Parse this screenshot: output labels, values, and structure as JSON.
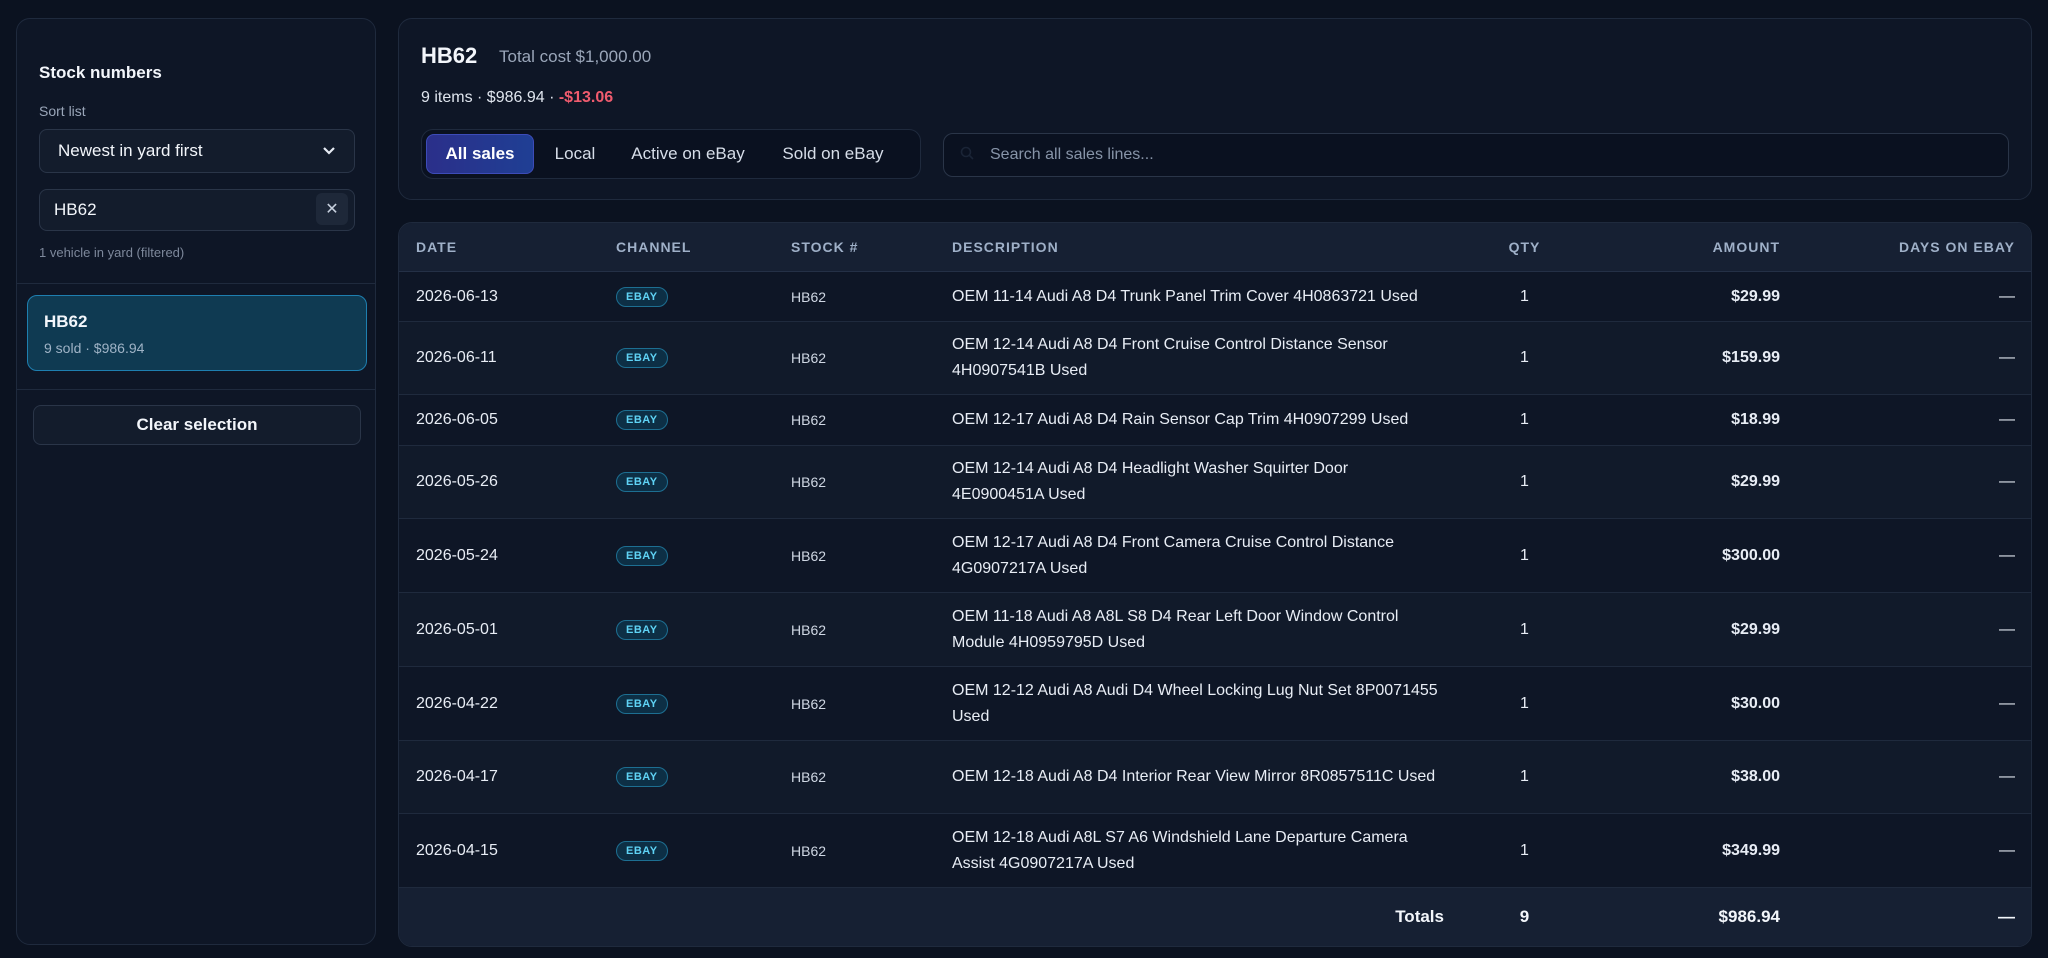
{
  "sidebar": {
    "title": "Stock numbers",
    "sort_label": "Sort list",
    "sort_value": "Newest in yard first",
    "search_value": "HB62",
    "clear_glyph": "✕",
    "count_text": "1 vehicle in yard (filtered)",
    "card": {
      "title": "HB62",
      "sub": "9 sold · $986.94"
    },
    "clear_selection": "Clear selection"
  },
  "header": {
    "title": "HB62",
    "total_cost": "Total cost $1,000.00",
    "summary": "9 items · $986.94 · ",
    "delta": "-$13.06",
    "tabs": [
      "All sales",
      "Local",
      "Active on eBay",
      "Sold on eBay"
    ],
    "active_tab": 0,
    "search_placeholder": "Search all sales lines..."
  },
  "table": {
    "columns": [
      "DATE",
      "CHANNEL",
      "STOCK #",
      "DESCRIPTION",
      "QTY",
      "AMOUNT",
      "DAYS ON EBAY"
    ],
    "rows": [
      {
        "date": "2026-06-13",
        "channel": "EBAY",
        "stock": "HB62",
        "desc": "OEM 11-14 Audi A8 D4 Trunk Panel Trim Cover 4H0863721 Used",
        "qty": "1",
        "amount": "$29.99",
        "days": "—"
      },
      {
        "date": "2026-06-11",
        "channel": "EBAY",
        "stock": "HB62",
        "desc": "OEM 12-14 Audi A8 D4 Front Cruise Control Distance Sensor 4H0907541B Used",
        "qty": "1",
        "amount": "$159.99",
        "days": "—"
      },
      {
        "date": "2026-06-05",
        "channel": "EBAY",
        "stock": "HB62",
        "desc": "OEM 12-17 Audi A8 D4 Rain Sensor Cap Trim 4H0907299 Used",
        "qty": "1",
        "amount": "$18.99",
        "days": "—"
      },
      {
        "date": "2026-05-26",
        "channel": "EBAY",
        "stock": "HB62",
        "desc": "OEM 12-14 Audi A8 D4 Headlight Washer Squirter Door 4E0900451A Used",
        "qty": "1",
        "amount": "$29.99",
        "days": "—"
      },
      {
        "date": "2026-05-24",
        "channel": "EBAY",
        "stock": "HB62",
        "desc": "OEM 12-17 Audi A8 D4 Front Camera Cruise Control Distance 4G0907217A Used",
        "qty": "1",
        "amount": "$300.00",
        "days": "—"
      },
      {
        "date": "2026-05-01",
        "channel": "EBAY",
        "stock": "HB62",
        "desc": "OEM 11-18 Audi A8 A8L S8 D4 Rear Left Door Window Control Module 4H0959795D Used",
        "qty": "1",
        "amount": "$29.99",
        "days": "—"
      },
      {
        "date": "2026-04-22",
        "channel": "EBAY",
        "stock": "HB62",
        "desc": "OEM 12-12 Audi A8 Audi D4 Wheel Locking Lug Nut Set 8P0071455 Used",
        "qty": "1",
        "amount": "$30.00",
        "days": "—"
      },
      {
        "date": "2026-04-17",
        "channel": "EBAY",
        "stock": "HB62",
        "desc": "OEM 12-18 Audi A8 D4 Interior Rear View Mirror 8R0857511C Used",
        "qty": "1",
        "amount": "$38.00",
        "days": "—"
      },
      {
        "date": "2026-04-15",
        "channel": "EBAY",
        "stock": "HB62",
        "desc": "OEM 12-18 Audi A8L S7 A6 Windshield Lane Departure Camera Assist 4G0907217A Used",
        "qty": "1",
        "amount": "$349.99",
        "days": "—"
      }
    ],
    "totals": {
      "label": "Totals",
      "qty": "9",
      "amount": "$986.94",
      "days": "—"
    }
  }
}
